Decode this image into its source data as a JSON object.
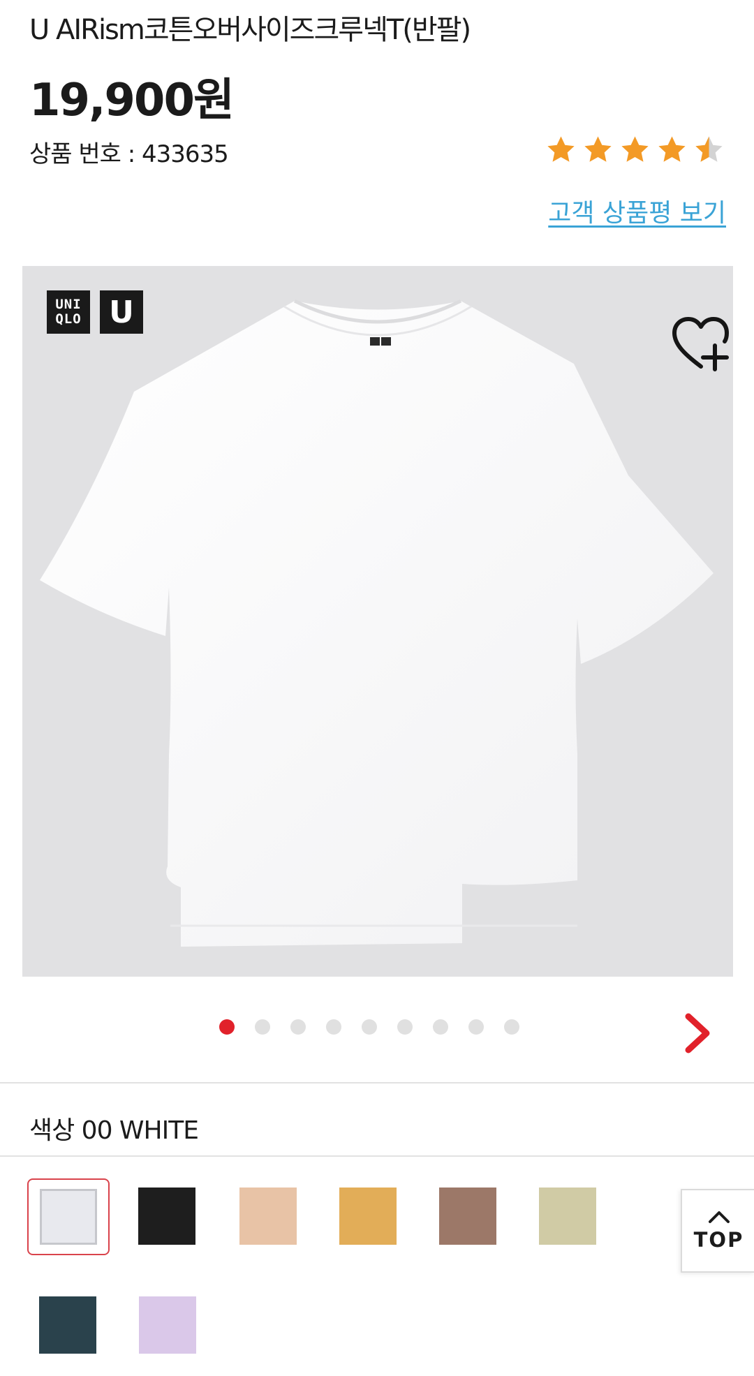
{
  "product": {
    "title": "U AIRism코튼오버사이즈크루넥T(반팔)",
    "price": "19,900원",
    "number_label": "상품 번호 : 433635",
    "rating": 4.5,
    "reviews_link": "고객 상품평 보기"
  },
  "gallery": {
    "logo_text": "UNI QLO",
    "logo_u": "U",
    "dots_total": 9,
    "active_dot": 1
  },
  "color_section": {
    "label": "색상 00 WHITE",
    "selected_index": 0,
    "swatches": [
      {
        "name": "white",
        "hex": "#e8e9ee"
      },
      {
        "name": "black",
        "hex": "#1e1e1e"
      },
      {
        "name": "beige",
        "hex": "#e8c3a6"
      },
      {
        "name": "mustard",
        "hex": "#e2ad58"
      },
      {
        "name": "brown",
        "hex": "#9c7868"
      },
      {
        "name": "light-olive",
        "hex": "#d0cba5"
      },
      {
        "name": "dark-teal",
        "hex": "#2a424c"
      },
      {
        "name": "lavender",
        "hex": "#dac8e9"
      }
    ]
  },
  "top_button": {
    "label": "TOP"
  },
  "colors": {
    "accent_red": "#e1212a",
    "star_orange": "#f39a26",
    "link_blue": "#3aa3d6"
  }
}
